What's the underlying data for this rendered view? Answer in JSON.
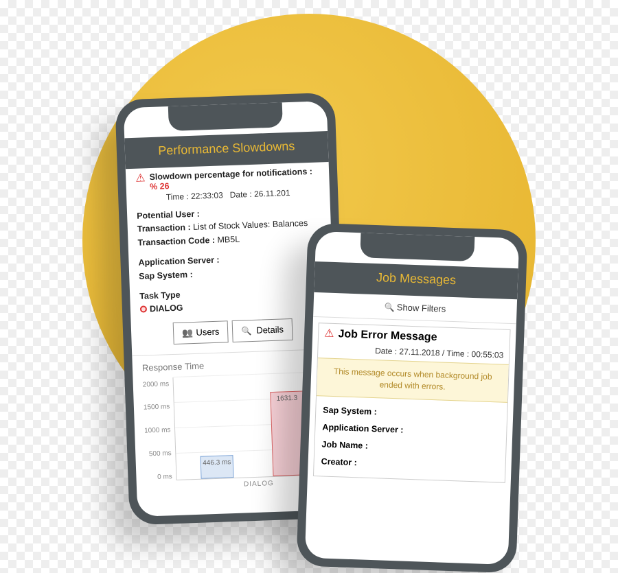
{
  "phone1": {
    "title": "Performance Slowdowns",
    "alert_label": "Slowdown percentage for notifications :",
    "alert_value": "% 26",
    "time_label": "Time :",
    "time_value": "22:33:03",
    "date_label": "Date :",
    "date_value": "26.11.201",
    "potential_user_label": "Potential User :",
    "transaction_label": "Transaction :",
    "transaction_value": "List of Stock Values: Balances",
    "transaction_code_label": "Transaction Code :",
    "transaction_code_value": "MB5L",
    "app_server_label": "Application Server :",
    "sap_system_label": "Sap System :",
    "task_type_label": "Task Type",
    "task_type_value": "DIALOG",
    "users_button": "Users",
    "details_button": "Details",
    "chart_title": "Response Time"
  },
  "chart_data": {
    "type": "bar",
    "categories": [
      "",
      "DIALOG"
    ],
    "values": [
      446.3,
      1631.3
    ],
    "value_labels": [
      "446.3 ms",
      "1631.3"
    ],
    "ylabel_unit": "ms",
    "ylim": [
      0,
      2000
    ],
    "yticks": [
      "2000 ms",
      "1500 ms",
      "1000 ms",
      "500 ms",
      "0 ms"
    ],
    "xlabel": "DIALOG"
  },
  "phone2": {
    "title": "Job Messages",
    "show_filters": "Show Filters",
    "error_title": "Job Error Message",
    "date_label": "Date :",
    "date_value": "27.11.2018",
    "time_label": "Time :",
    "time_value": "00:55:03",
    "message": "This message occurs when background job ended with errors.",
    "sap_system_label": "Sap System :",
    "app_server_label": "Application Server :",
    "job_name_label": "Job Name :",
    "creator_label": "Creator :"
  }
}
